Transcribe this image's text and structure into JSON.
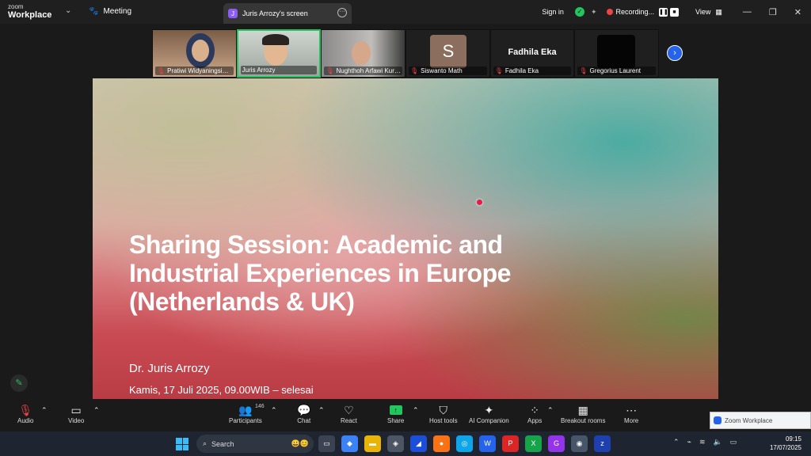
{
  "titlebar": {
    "logo_small": "zoom",
    "logo_big": "Workplace",
    "meeting_label": "Meeting",
    "screen_tab": "Juris Arrozy's screen",
    "screen_tab_avatar": "J",
    "sign_in": "Sign in",
    "recording": "Recording...",
    "view": "View"
  },
  "participants_strip": [
    {
      "name": "Pratiwi Widyaningsih_..."
    },
    {
      "name": "Juris Arrozy"
    },
    {
      "name": "Nughthoh Arfawi Kurd..."
    },
    {
      "name": "Siswanto Math",
      "avatar": "S"
    },
    {
      "name": "Fadhila Eka",
      "label": "Fadhila Eka"
    },
    {
      "name": "Gregorius Laurent"
    }
  ],
  "slide": {
    "title": "Sharing Session: Academic and Industrial Experiences in Europe (Netherlands & UK)",
    "presenter": "Dr. Juris Arrozy",
    "date": "Kamis, 17 Juli 2025, 09.00WIB – selesai"
  },
  "toolbar": {
    "audio": "Audio",
    "video": "Video",
    "participants": "Participants",
    "participant_count": "146",
    "chat": "Chat",
    "react": "React",
    "share": "Share",
    "host_tools": "Host tools",
    "ai_companion": "AI Companion",
    "apps": "Apps",
    "breakout_rooms": "Breakout rooms",
    "more": "More"
  },
  "popup": {
    "label": "Zoom Workplace"
  },
  "taskbar": {
    "search_placeholder": "Search",
    "time": "09:15",
    "date": "17/07/2025"
  },
  "colors": {
    "accent_green": "#22c55e",
    "record_red": "#ef4444",
    "zoom_blue": "#2563eb"
  }
}
